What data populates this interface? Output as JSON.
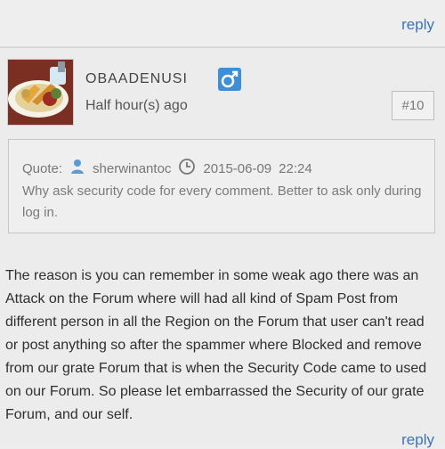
{
  "top_bar": {
    "reply_label": "reply"
  },
  "post": {
    "username": "OBAADENUSI",
    "time": "Half hour(s) ago",
    "post_number": "#10",
    "gender_icon": "male-icon",
    "quote": {
      "label": "Quote:",
      "quoted_user": "sherwinantoc",
      "date": "2015-06-09",
      "time": "22:24",
      "text": "Why ask security code for every comment. Better to ask only during log in."
    },
    "body": "The reason is you can remember in some weak ago there was an Attack on the Forum where will had all kind of Spam Post from different person in all the Region on the Forum that user can't read or post anything so after the spammer where Blocked and remove from our grate Forum that is when the Security Code came to used on our Forum. So please let embarrassed the Security of our grate Forum, and our self.",
    "reply_label": "reply"
  },
  "colors": {
    "link": "#3b73b9",
    "background": "#ececec",
    "gender_badge": "#3d8fd8"
  }
}
